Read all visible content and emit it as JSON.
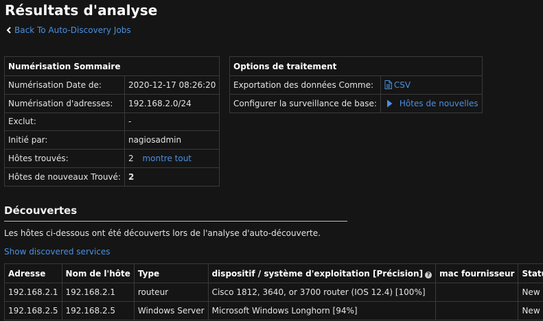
{
  "page": {
    "title": "Résultats d'analyse",
    "back_link": "Back To Auto-Discovery Jobs"
  },
  "summary": {
    "header": "Numérisation Sommaire",
    "rows": [
      {
        "label": "Numérisation Date de:",
        "value": "2020-12-17 08:26:20"
      },
      {
        "label": "Numérisation d'adresses:",
        "value": "192.168.2.0/24"
      },
      {
        "label": "Exclut:",
        "value": "-"
      },
      {
        "label": "Initié par:",
        "value": "nagiosadmin"
      },
      {
        "label": "Hôtes trouvés:",
        "value": "2",
        "link": "montre tout"
      },
      {
        "label": "Hôtes de nouveaux Trouvé:",
        "value": "2"
      }
    ]
  },
  "options": {
    "header": "Options de traitement",
    "export_label": "Exportation des données Comme:",
    "export_link": "CSV",
    "export_icon": "document-icon",
    "monitor_label": "Configurer la surveillance de base:",
    "monitor_link": "Hôtes de nouvelles",
    "monitor_icon": "play-icon"
  },
  "discoveries": {
    "title": "Découvertes",
    "description": "Les hôtes ci-dessous ont été découverts lors de l'analyse d'auto-découverte.",
    "show_services": "Show discovered services",
    "columns": [
      "Adresse",
      "Nom de l'hôte",
      "Type",
      "dispositif / système d'exploitation [Précision]",
      "mac fournisseur",
      "Statut"
    ],
    "help_glyph": "?",
    "rows": [
      {
        "address": "192.168.2.1",
        "hostname": "192.168.2.1",
        "type": "routeur",
        "os": "Cisco 1812, 3640, or 3700 router (IOS 12.4) [100%]",
        "mac": "",
        "status": "New"
      },
      {
        "address": "192.168.2.5",
        "hostname": "192.168.2.5",
        "type": "Windows Server",
        "os": "Microsoft Windows Longhorn [94%]",
        "mac": "",
        "status": "New"
      }
    ]
  },
  "colors": {
    "background": "#151515",
    "link": "#4a90e2",
    "border": "#3a3a3a"
  }
}
